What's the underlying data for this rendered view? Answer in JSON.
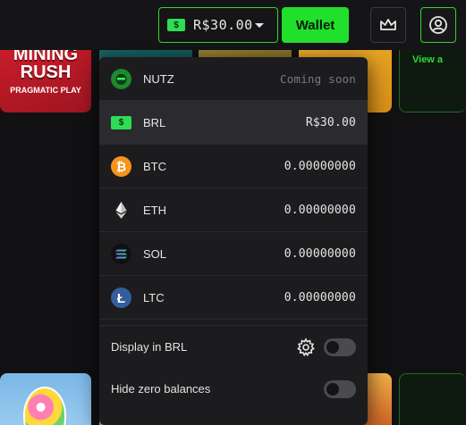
{
  "header": {
    "balance_currency_icon": "cash-icon",
    "balance_currency_symbol": "$",
    "balance_amount": "R$30.00",
    "wallet_label": "Wallet"
  },
  "background_tiles": {
    "mining_title": "MINING\nRUSH",
    "mining_subtitle": "PRAGMATIC PLAY",
    "view_all_label": "View a"
  },
  "currencies": [
    {
      "code": "NUTZ",
      "value": "Coming soon",
      "icon": "nutz-icon"
    },
    {
      "code": "BRL",
      "value": "R$30.00",
      "icon": "cash-icon",
      "selected": true
    },
    {
      "code": "BTC",
      "value": "0.00000000",
      "icon": "bitcoin-icon"
    },
    {
      "code": "ETH",
      "value": "0.00000000",
      "icon": "ethereum-icon"
    },
    {
      "code": "SOL",
      "value": "0.00000000",
      "icon": "solana-icon"
    },
    {
      "code": "LTC",
      "value": "0.00000000",
      "icon": "litecoin-icon"
    }
  ],
  "settings": {
    "display_in_label": "Display in BRL",
    "hide_zero_label": "Hide zero balances",
    "display_in_enabled": false,
    "hide_zero_enabled": false
  },
  "colors": {
    "accent_green": "#21e02c",
    "btc_orange": "#f7931a",
    "ltc_blue": "#345d9d"
  }
}
